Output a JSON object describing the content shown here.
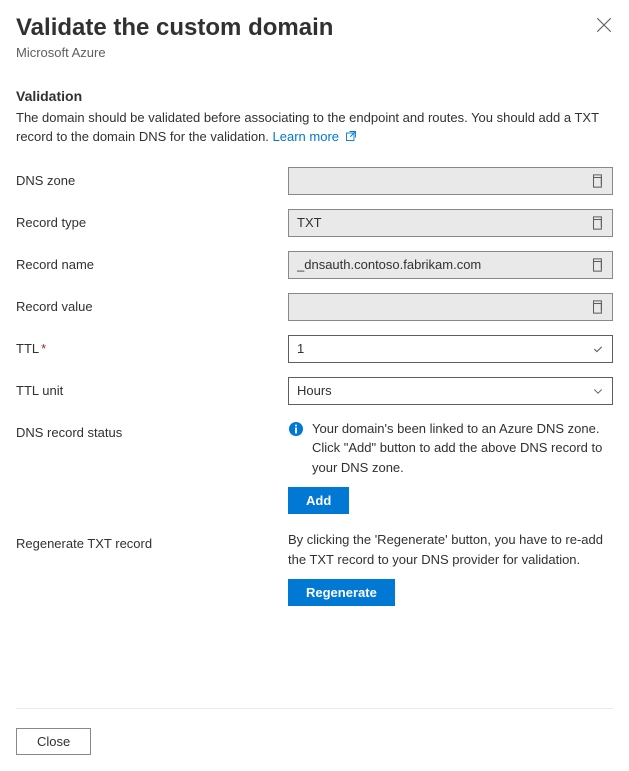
{
  "header": {
    "title": "Validate the custom domain",
    "subtitle": "Microsoft Azure"
  },
  "validation": {
    "heading": "Validation",
    "description_part1": "The domain should be validated before associating to the endpoint and routes. You should add a TXT record to the domain DNS for the validation. ",
    "learn_more": "Learn more"
  },
  "fields": {
    "dns_zone": {
      "label": "DNS zone",
      "value": ""
    },
    "record_type": {
      "label": "Record type",
      "value": "TXT"
    },
    "record_name": {
      "label": "Record name",
      "value": "_dnsauth.contoso.fabrikam.com"
    },
    "record_value": {
      "label": "Record value",
      "value": ""
    },
    "ttl": {
      "label": "TTL",
      "value": "1"
    },
    "ttl_unit": {
      "label": "TTL unit",
      "value": "Hours"
    }
  },
  "dns_status": {
    "label": "DNS record status",
    "info_text": "Your domain's been linked to an Azure DNS zone. Click \"Add\" button to add the above DNS record to your DNS zone.",
    "button": "Add"
  },
  "regenerate": {
    "label": "Regenerate TXT record",
    "description": "By clicking the 'Regenerate' button, you have to re-add the TXT record to your DNS provider for validation.",
    "button": "Regenerate"
  },
  "footer": {
    "close": "Close"
  }
}
